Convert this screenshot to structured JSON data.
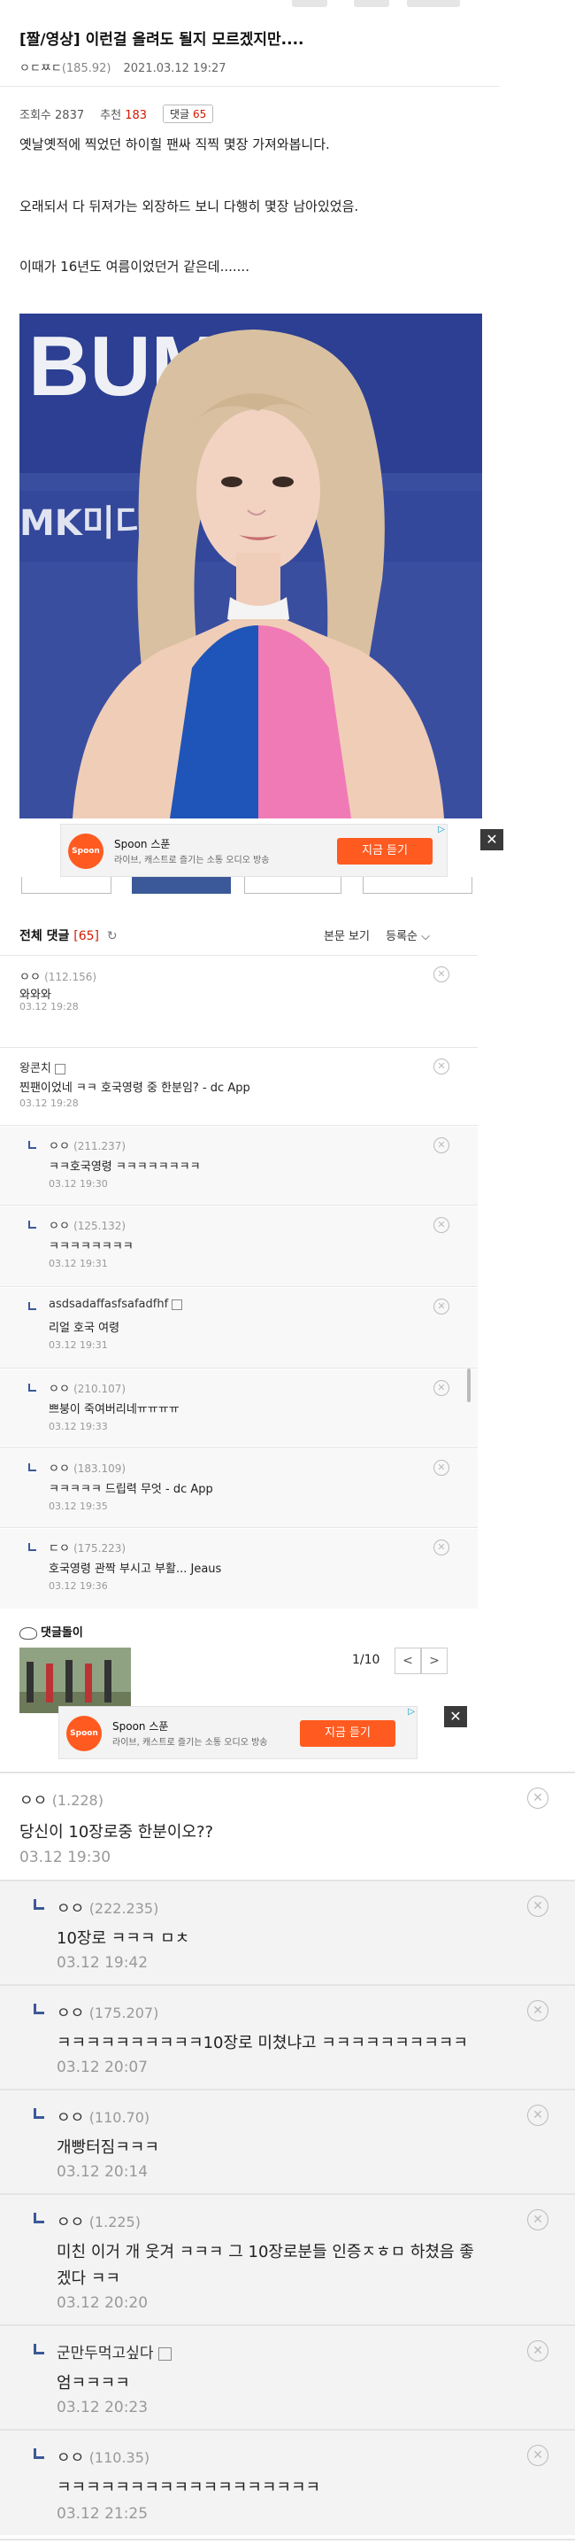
{
  "post": {
    "title": "[짤/영상] 이런걸 올려도 될지 모르겠지만....",
    "author": "ㅇㄷㅉㄷ",
    "author_ip": "(185.92)",
    "date": "2021.03.12 19:27",
    "views_label": "조회수",
    "views": "2837",
    "recommend_label": "추천",
    "recommend": "183",
    "comments_label": "댓글",
    "comments_count": "65",
    "paragraphs": [
      "옛날옛적에 찍었던 하이힐 팬싸 직찍 몇장 가져와봅니다.",
      "오래되서 다 뒤져가는 외장하드 보니 다행히 몇장 남아있었음.",
      "이때가 16년도 여름이었던거 같은데......."
    ],
    "photo_sign_text": "BUMI",
    "photo_sign_text2": "MK미디"
  },
  "ad": {
    "logo_text": "Spoon",
    "name": "Spoon 스푼",
    "desc": "라이브, 캐스트로 즐기는 소통 오디오 방송",
    "cta": "지금 듣기",
    "close": "✕",
    "adchoice": "▷"
  },
  "comments_header": {
    "label": "전체 댓글",
    "count": "[65]",
    "refresh_icon": "↻",
    "view_label": "본문 보기",
    "sort_label": "등록순 ⌵"
  },
  "comments": [
    {
      "nick": "ㅇㅇ",
      "ip": "(112.156)",
      "text": "와와와",
      "date": "03.12 19:28",
      "reply": false
    },
    {
      "nick": "왕콘치",
      "ip": "",
      "text": "찐팬이었네 ㅋㅋ 호국영령 중 한분임? - dc App",
      "date": "03.12 19:28",
      "reply": false
    },
    {
      "nick": "ㅇㅇ",
      "ip": "(211.237)",
      "text": "ㅋㅋ호국영령 ㅋㅋㅋㅋㅋㅋㅋㅋ",
      "date": "03.12 19:30",
      "reply": true
    },
    {
      "nick": "ㅇㅇ",
      "ip": "(125.132)",
      "text": "ㅋㅋㅋㅋㅋㅋㅋㅋ",
      "date": "03.12 19:31",
      "reply": true
    },
    {
      "nick": "asdsadaffasfsafadfhf",
      "ip": "",
      "text": "리얼 호국 여령",
      "date": "03.12 19:31",
      "reply": true
    },
    {
      "nick": "ㅇㅇ",
      "ip": "(210.107)",
      "text": "쁘붕이 죽여버리네ㅠㅠㅠㅠ",
      "date": "03.12 19:33",
      "reply": true
    },
    {
      "nick": "ㅇㅇ",
      "ip": "(183.109)",
      "text": "ㅋㅋㅋㅋㅋ 드립력 무엇 - dc App",
      "date": "03.12 19:35",
      "reply": true
    },
    {
      "nick": "ㄷㅇ",
      "ip": "(175.223)",
      "text": "호국영령 관짝 부시고 부활... Jeaus",
      "date": "03.12 19:36",
      "reply": true
    }
  ],
  "dolgul": {
    "label": "댓글돌이",
    "pager": "1/10",
    "prev": "<",
    "next": ">"
  },
  "big_comments": [
    {
      "nick": "ㅇㅇ",
      "ip": "(1.228)",
      "text": "당신이 10장로중 한분이오??",
      "date": "03.12 19:30",
      "reply": false
    },
    {
      "nick": "ㅇㅇ",
      "ip": "(222.235)",
      "text": "10장로 ㅋㅋㅋ ㅁㅊ",
      "date": "03.12 19:42",
      "reply": true
    },
    {
      "nick": "ㅇㅇ",
      "ip": "(175.207)",
      "text": "ㅋㅋㅋㅋㅋㅋㅋㅋㅋㅋ10장로 미쳤냐고 ㅋㅋㅋㅋㅋㅋㅋㅋㅋㅋ",
      "date": "03.12 20:07",
      "reply": true
    },
    {
      "nick": "ㅇㅇ",
      "ip": "(110.70)",
      "text": "개빵터짐ㅋㅋㅋ",
      "date": "03.12 20:14",
      "reply": true
    },
    {
      "nick": "ㅇㅇ",
      "ip": "(1.225)",
      "text": "미친 이거 개 웃겨 ㅋㅋㅋ 그 10장로분들 인증ㅈㅎㅁ 하쳤음 좋",
      "text2": "겠다 ㅋㅋ",
      "date": "03.12 20:20",
      "reply": true
    },
    {
      "nick": "군만두먹고싶다",
      "ip": "",
      "text": "엄ㅋㅋㅋㅋ",
      "date": "03.12 20:23",
      "reply": true
    },
    {
      "nick": "ㅇㅇ",
      "ip": "(110.35)",
      "text": "ㅋㅋㅋㅋㅋㅋㅋㅋㅋㅋㅋㅋㅋㅋㅋㅋㅋㅋ",
      "date": "03.12 21:25",
      "reply": true
    }
  ],
  "colors": {
    "accent_red": "#d31900",
    "accent_blue": "#3b5998",
    "ad_orange": "#ff5a1f"
  }
}
